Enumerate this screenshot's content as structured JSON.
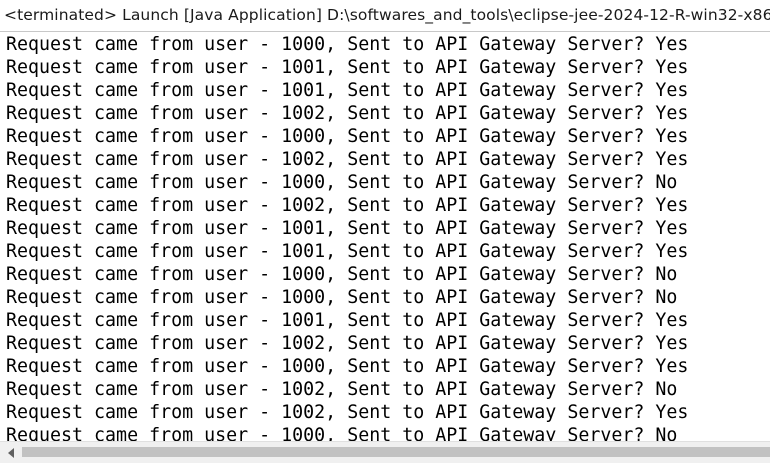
{
  "console": {
    "title": "<terminated> Launch [Java Application] D:\\softwares_and_tools\\eclipse-jee-2024-12-R-win32-x86",
    "lines": [
      "Request came from user - 1000, Sent to API Gateway Server? Yes",
      "Request came from user - 1001, Sent to API Gateway Server? Yes",
      "Request came from user - 1001, Sent to API Gateway Server? Yes",
      "Request came from user - 1002, Sent to API Gateway Server? Yes",
      "Request came from user - 1000, Sent to API Gateway Server? Yes",
      "Request came from user - 1002, Sent to API Gateway Server? Yes",
      "Request came from user - 1000, Sent to API Gateway Server? No",
      "Request came from user - 1002, Sent to API Gateway Server? Yes",
      "Request came from user - 1001, Sent to API Gateway Server? Yes",
      "Request came from user - 1001, Sent to API Gateway Server? Yes",
      "Request came from user - 1000, Sent to API Gateway Server? No",
      "Request came from user - 1000, Sent to API Gateway Server? No",
      "Request came from user - 1001, Sent to API Gateway Server? Yes",
      "Request came from user - 1002, Sent to API Gateway Server? Yes",
      "Request came from user - 1000, Sent to API Gateway Server? Yes",
      "Request came from user - 1002, Sent to API Gateway Server? No",
      "Request came from user - 1002, Sent to API Gateway Server? Yes",
      "Request came from user - 1000, Sent to API Gateway Server? No"
    ]
  },
  "scrollbar": {
    "left_arrow_icon": "chevron-left-icon"
  },
  "colors": {
    "background": "#ffffff",
    "text": "#000000",
    "scrollbar_track": "#f0f0f0",
    "scrollbar_thumb": "#c2c2c2"
  }
}
